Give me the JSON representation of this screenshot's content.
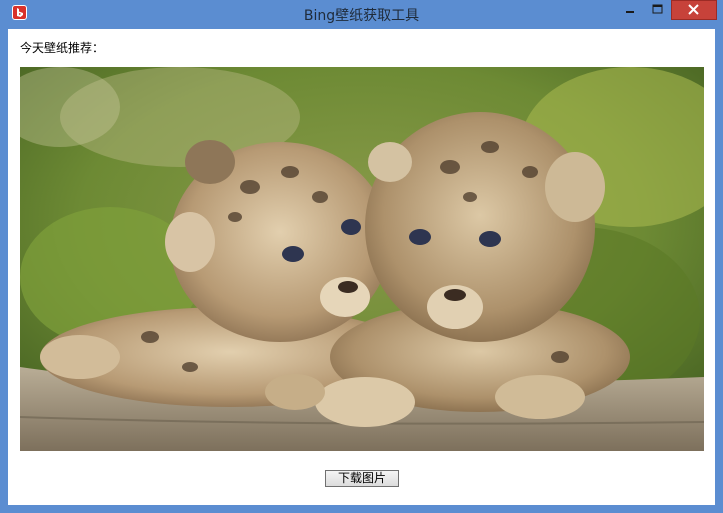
{
  "window": {
    "title": "Bing壁纸获取工具",
    "app_icon": "bing-b-icon",
    "accent_color": "#5b8dd1",
    "close_color": "#c7423a"
  },
  "controls": {
    "minimize_icon": "minimize-icon",
    "maximize_icon": "maximize-icon",
    "close_icon": "close-icon"
  },
  "main": {
    "today_label": "今天壁纸推荐：",
    "wallpaper_subject": "two-cougar-cubs-photo",
    "download_button": "下载图片"
  }
}
